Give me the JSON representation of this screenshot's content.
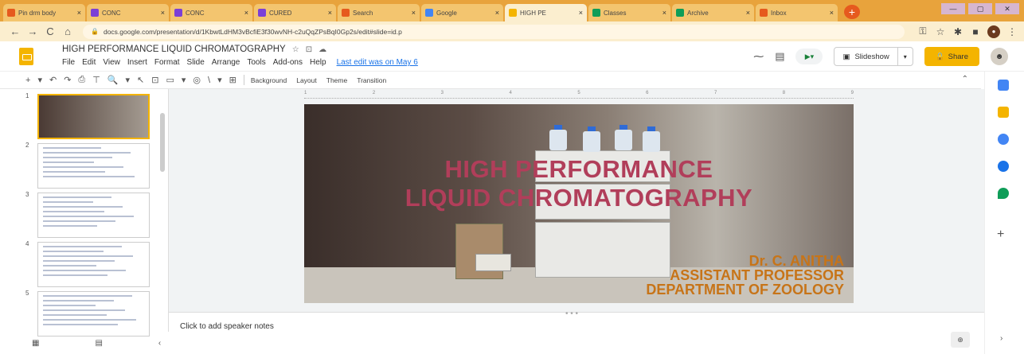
{
  "browser": {
    "tabs": [
      {
        "label": "Pin drm body",
        "color": "#e65a1e"
      },
      {
        "label": "CONC",
        "color": "#7b3fd6"
      },
      {
        "label": "CONC",
        "color": "#7b3fd6"
      },
      {
        "label": "CURED",
        "color": "#7b3fd6"
      },
      {
        "label": "Search",
        "color": "#e65a1e"
      },
      {
        "label": "Google",
        "color": "#4285f4"
      },
      {
        "label": "HIGH PE",
        "color": "#f4b400"
      },
      {
        "label": "Classes",
        "color": "#0f9d58"
      },
      {
        "label": "Archive",
        "color": "#0f9d58"
      },
      {
        "label": "Inbox",
        "color": "#e65a1e"
      }
    ],
    "active_tab_index": 6,
    "tab_close": "×",
    "new_tab": "+",
    "window_controls": [
      "—",
      "▢",
      "✕"
    ],
    "url": "docs.google.com/presentation/d/1KbwtLdHM3vBcfiE3f30wvNH-c2uQqZPsBqI0Gp2s/edit#slide=id.p",
    "nav": {
      "back": "←",
      "forward": "→",
      "reload": "C",
      "home": "⌂"
    }
  },
  "doc": {
    "title": "HIGH PERFORMANCE LIQUID CHROMATOGRAPHY",
    "star": "☆",
    "move": "⊡",
    "cloud": "☁",
    "menus": [
      "File",
      "Edit",
      "View",
      "Insert",
      "Format",
      "Slide",
      "Arrange",
      "Tools",
      "Add-ons",
      "Help"
    ],
    "last_edit": "Last edit was on May 6",
    "slideshow_label": "Slideshow",
    "share_label": "Share",
    "meet_label": "Meet"
  },
  "toolbar": {
    "icons": [
      "+",
      "▾",
      "↶",
      "↷",
      "⎙",
      "⊤",
      "🔍",
      "▾",
      "↖",
      "⊡",
      "▭",
      "▾",
      "◎",
      "\\",
      "▾",
      "⊞"
    ],
    "text_buttons": [
      "Background",
      "Layout",
      "Theme",
      "Transition"
    ],
    "collapse": "⌃"
  },
  "filmstrip": {
    "slide_numbers": [
      "1",
      "2",
      "3",
      "4",
      "5"
    ],
    "grid_view": "▦",
    "list_view": "▤",
    "collapse": "‹"
  },
  "ruler_marks": [
    "1",
    "2",
    "3",
    "4",
    "5",
    "6",
    "7",
    "8",
    "9"
  ],
  "slide": {
    "title_line1": "HIGH PERFORMANCE",
    "title_line2": "LIQUID CHROMATOGRAPHY",
    "author_name": "Dr. C. ANITHA",
    "author_role": "ASSISTANT PROFESSOR",
    "author_dept": "DEPARTMENT OF ZOOLOGY",
    "colors": {
      "title": "#b13e5a",
      "author": "#c77418"
    }
  },
  "notes": {
    "placeholder": "Click to add speaker notes",
    "resize": "• • •",
    "explore": "⊕"
  },
  "sidebar": {
    "add": "+",
    "expand": "›"
  }
}
